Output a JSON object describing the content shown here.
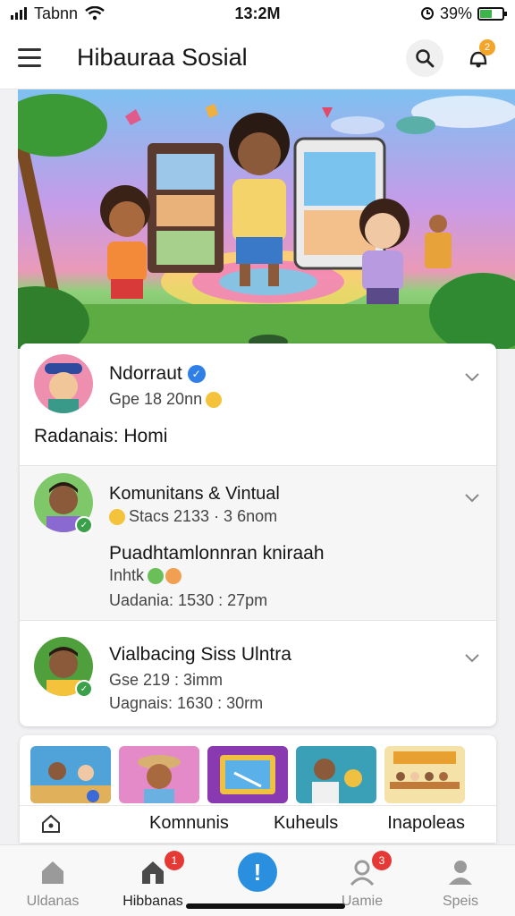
{
  "status_bar": {
    "carrier": "Tabnn",
    "time": "13:2M",
    "battery": "39%"
  },
  "header": {
    "title": "Hibauraa Sosial",
    "notification_count": "2",
    "icons": [
      "menu-icon",
      "search-icon",
      "notification-icon"
    ]
  },
  "hero": {
    "description_icon": "hero-illustration"
  },
  "feed": {
    "posts": [
      {
        "name": "Ndorraut",
        "meta": "Gpe 18 20nn",
        "body": "Radanais: Homi"
      },
      {
        "name": "Komunitans & Vintual",
        "meta": "Stacs 2133 · 3 6nom",
        "title": "Puadhtamlonnran kniraah",
        "line1": "Inhtk",
        "line2": "Uadania: 1530 : 27pm"
      },
      {
        "name": "Vialbacing Siss Ulntra",
        "meta": "Gse 219 : 3imm",
        "line2": "Uagnais: 1630 : 30rm"
      }
    ]
  },
  "strip": {
    "tabs": [
      "Komnunis",
      "Kuheuls",
      "Inapoleas"
    ]
  },
  "bottom_nav": {
    "items": [
      {
        "label": "Uldanas"
      },
      {
        "label": "Hibbanas",
        "badge": "1"
      },
      {
        "label": ""
      },
      {
        "label": "Uamie",
        "badge": "3"
      },
      {
        "label": "Speis"
      }
    ],
    "fab_symbol": "!"
  },
  "colors": {
    "accent": "#2b8fe0",
    "badge_red": "#e53935",
    "badge_orange": "#f3a52a",
    "verified": "#2f7fe6"
  }
}
